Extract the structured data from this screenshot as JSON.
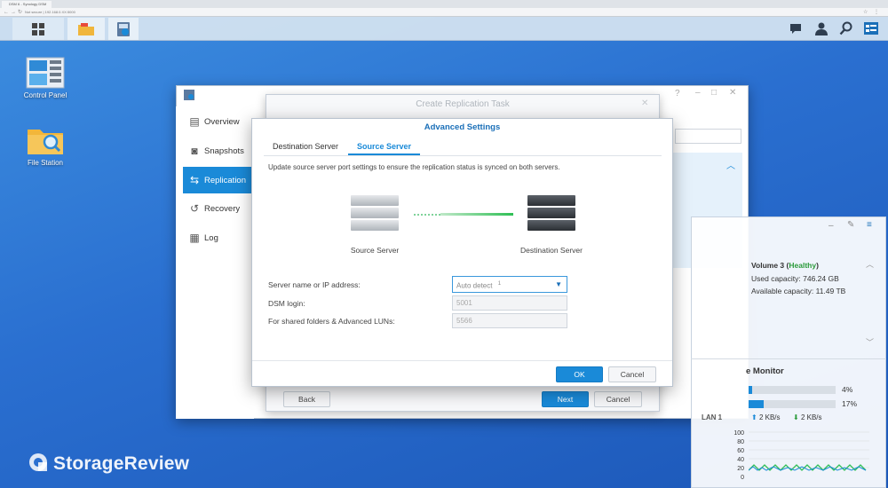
{
  "browser": {
    "tab_title": "DSM 6 - Synology DSM",
    "address": "Not secure | 192.168.0.XX:5000"
  },
  "desktop": {
    "icons": [
      {
        "label": "Control Panel"
      },
      {
        "label": "File Station"
      }
    ]
  },
  "sidebar": {
    "items": [
      {
        "label": "Overview",
        "icon": "overview-icon"
      },
      {
        "label": "Snapshots",
        "icon": "camera-icon"
      },
      {
        "label": "Replication",
        "icon": "replication-icon"
      },
      {
        "label": "Recovery",
        "icon": "recovery-icon"
      },
      {
        "label": "Log",
        "icon": "log-icon"
      }
    ],
    "active": "Replication"
  },
  "wizard": {
    "title": "Create Replication Task",
    "back_label": "Back",
    "next_label": "Next",
    "cancel_label": "Cancel"
  },
  "advanced": {
    "title": "Advanced Settings",
    "tabs": [
      {
        "label": "Destination Server"
      },
      {
        "label": "Source Server"
      }
    ],
    "active_tab": "Source Server",
    "description": "Update source server port settings to ensure the replication status is synced on both servers.",
    "source_label": "Source Server",
    "destination_label": "Destination Server",
    "fields": [
      {
        "label": "Server name or IP address:",
        "value": "Auto detect",
        "footnote": "1"
      },
      {
        "label": "DSM login:",
        "value": "5001"
      },
      {
        "label": "For shared folders & Advanced LUNs:",
        "value": "5566"
      }
    ],
    "ok_label": "OK",
    "cancel_label": "Cancel"
  },
  "volume": {
    "name": "Volume 3",
    "status": "Healthy",
    "used": "Used capacity: 746.24 GB",
    "available": "Available capacity: 11.49 TB"
  },
  "monitor": {
    "title": "e Monitor",
    "cpu_percent": 4,
    "cpu_label": "4%",
    "ram_percent": 17,
    "ram_label": "17%",
    "lan_label": "LAN 1",
    "upload": "2 KB/s",
    "download": "2 KB/s",
    "y_ticks": [
      "100",
      "80",
      "60",
      "40",
      "20",
      "0"
    ]
  },
  "watermark": "StorageReview",
  "colors": {
    "accent": "#1a8ad8",
    "healthy": "#2a9a3a"
  }
}
